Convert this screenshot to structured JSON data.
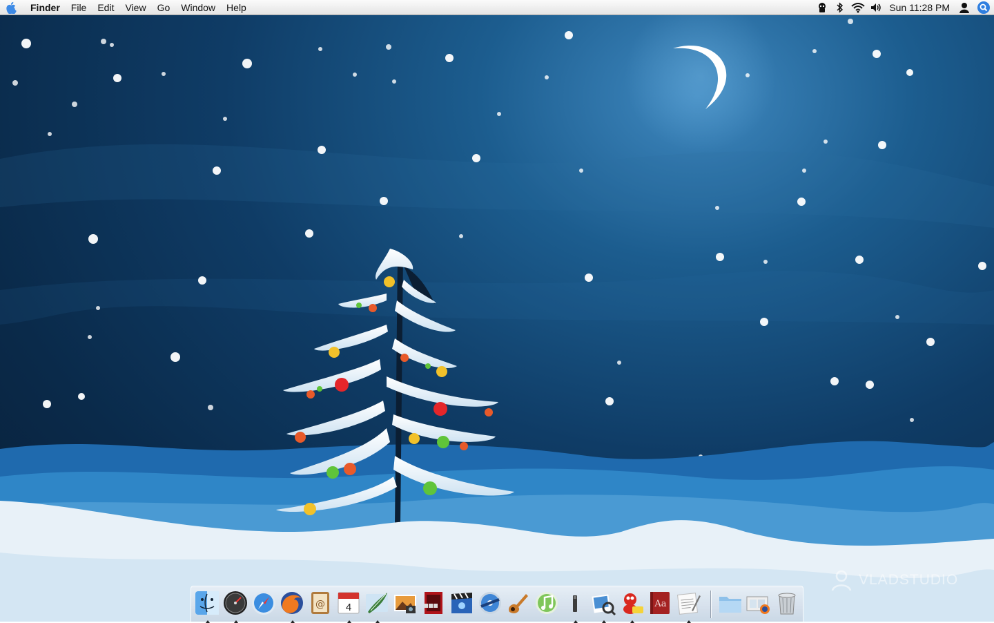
{
  "menubar": {
    "app_name": "Finder",
    "menus": [
      "File",
      "Edit",
      "View",
      "Go",
      "Window",
      "Help"
    ],
    "clock": "Sun 11:28 PM",
    "status_icons": [
      "vpn-icon",
      "bluetooth-icon",
      "wifi-icon",
      "volume-icon",
      "user-icon",
      "spotlight-icon"
    ]
  },
  "wallpaper": {
    "watermark": "VLADSTUDIO",
    "colors": {
      "sky_dark": "#0a2a4a",
      "sky_light": "#3f88bf",
      "snow": "#ffffff",
      "hill": "#1f6aae"
    }
  },
  "dock": {
    "apps": [
      "finder-icon",
      "dashboard-icon",
      "safari-icon",
      "firefox-icon",
      "address-book-icon",
      "ical-icon",
      "mail-icon",
      "iphoto-icon",
      "photo-booth-icon",
      "imovie-icon",
      "dvd-player-icon",
      "garageband-icon",
      "itunes-icon",
      "terminal-icon",
      "preview-icon",
      "adium-icon",
      "dictionary-icon",
      "textedit-icon"
    ],
    "right": [
      "documents-folder-icon",
      "downloads-stack-icon",
      "trash-icon"
    ],
    "calendar_day": "4"
  }
}
